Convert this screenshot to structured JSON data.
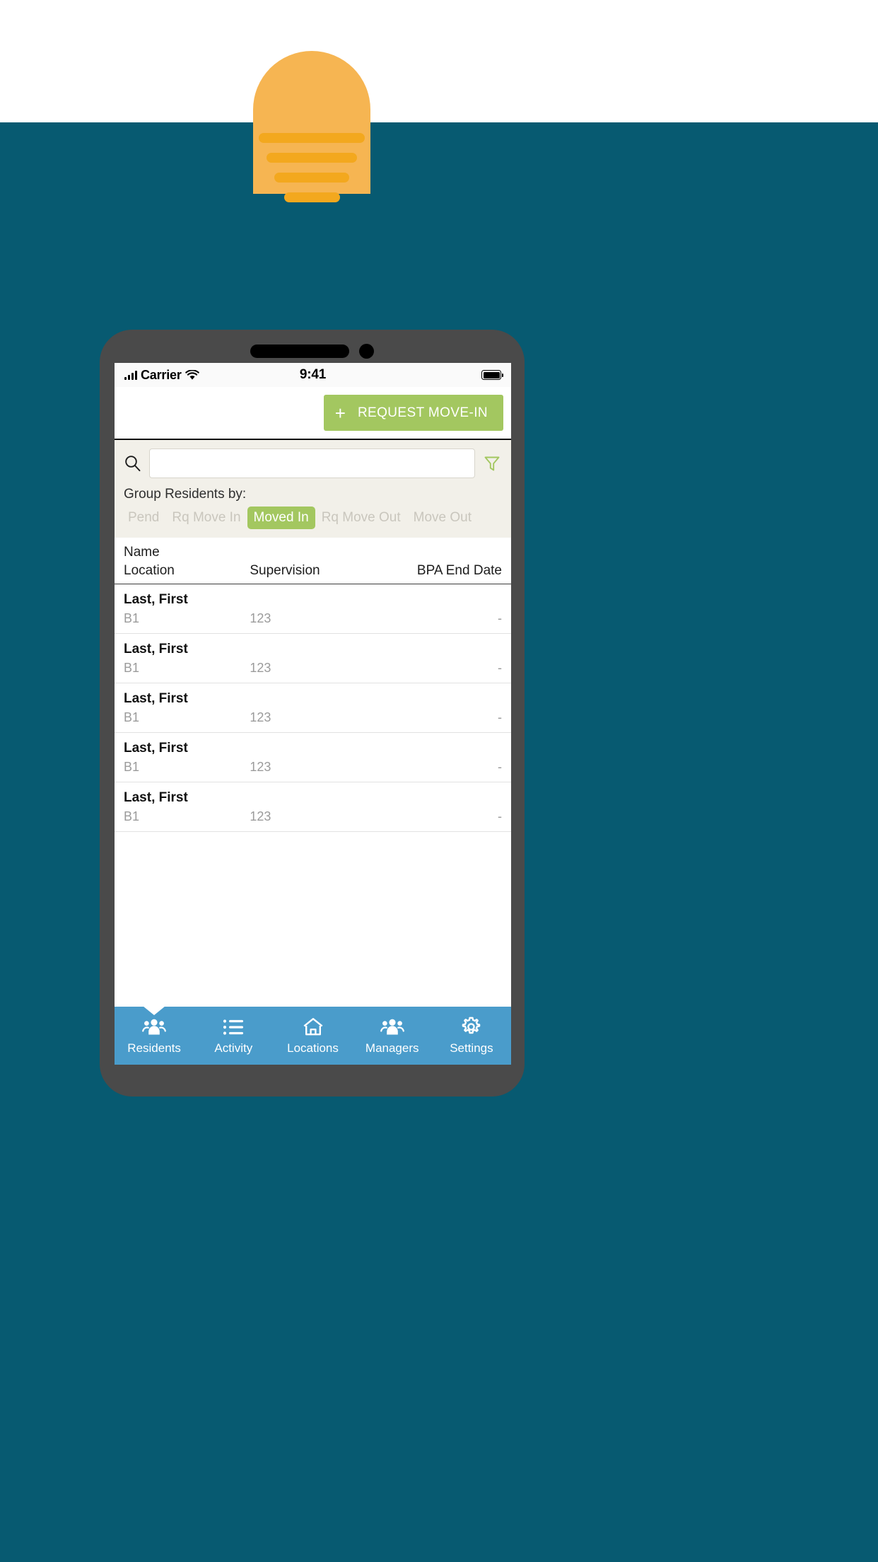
{
  "branding": {
    "logo_name": "sunset-logo",
    "sun_color": "#F6B552",
    "ray_color": "#F3A81E",
    "background_color": "#075A71"
  },
  "status_bar": {
    "carrier": "Carrier",
    "time": "9:41",
    "signal_icon": "signal-bars-icon",
    "wifi_icon": "wifi-icon",
    "battery_icon": "battery-full-icon"
  },
  "action_bar": {
    "request_move_in_plus": "+",
    "request_move_in_label": "REQUEST MOVE-IN",
    "button_color": "#A3C760"
  },
  "search": {
    "value": "",
    "placeholder": "",
    "search_icon": "search-icon",
    "filter_icon": "filter-funnel-icon"
  },
  "group_by": {
    "label": "Group Residents by:",
    "tabs": [
      {
        "label": "Pend",
        "active": false
      },
      {
        "label": "Rq Move In",
        "active": false
      },
      {
        "label": "Moved In",
        "active": true
      },
      {
        "label": "Rq Move Out",
        "active": false
      },
      {
        "label": "Move Out",
        "active": false
      }
    ]
  },
  "table": {
    "header": {
      "name": "Name",
      "location": "Location",
      "supervision": "Supervision",
      "bpa_end_date": "BPA End Date"
    },
    "rows": [
      {
        "name": "Last, First",
        "location": "B1",
        "supervision": "123",
        "bpa_end_date": "-"
      },
      {
        "name": "Last, First",
        "location": "B1",
        "supervision": "123",
        "bpa_end_date": "-"
      },
      {
        "name": "Last, First",
        "location": "B1",
        "supervision": "123",
        "bpa_end_date": "-"
      },
      {
        "name": "Last, First",
        "location": "B1",
        "supervision": "123",
        "bpa_end_date": "-"
      },
      {
        "name": "Last, First",
        "location": "B1",
        "supervision": "123",
        "bpa_end_date": "-"
      }
    ]
  },
  "bottom_nav": {
    "background_color": "#4A9CCB",
    "items": [
      {
        "label": "Residents",
        "icon": "people-group-icon",
        "active": true
      },
      {
        "label": "Activity",
        "icon": "list-icon",
        "active": false
      },
      {
        "label": "Locations",
        "icon": "home-icon",
        "active": false
      },
      {
        "label": "Managers",
        "icon": "people-group-icon",
        "active": false
      },
      {
        "label": "Settings",
        "icon": "gear-icon",
        "active": false
      }
    ]
  }
}
